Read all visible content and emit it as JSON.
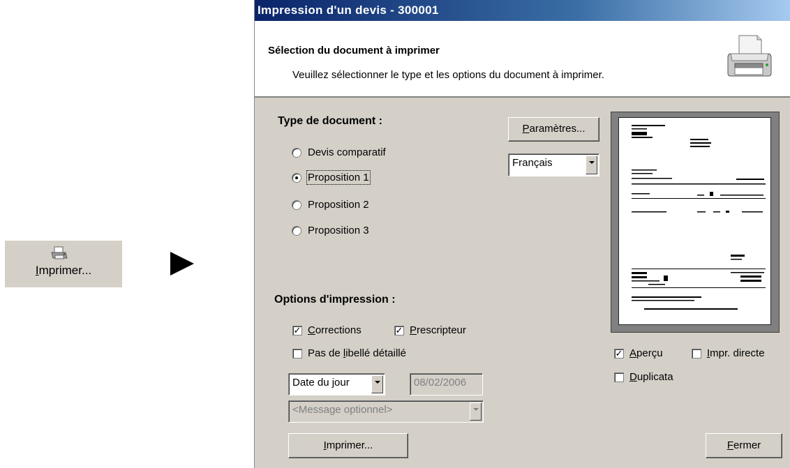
{
  "toolbar": {
    "print_label": "Imprimer..."
  },
  "dialog": {
    "title": "Impression d'un devis  -  300001",
    "header": {
      "title": "Sélection du document à imprimer",
      "subtitle": "Veuillez sélectionner le type et les options du document à imprimer."
    },
    "type_section": {
      "title": "Type de document :",
      "options": [
        {
          "label": "Devis comparatif",
          "selected": false
        },
        {
          "label": "Proposition 1",
          "selected": true
        },
        {
          "label": "Proposition 2",
          "selected": false
        },
        {
          "label": "Proposition 3",
          "selected": false
        }
      ]
    },
    "params_button": "Paramètres...",
    "language_select": {
      "value": "Français"
    },
    "options_section": {
      "title": "Options d'impression :",
      "corrections": {
        "label": "Corrections",
        "checked": true
      },
      "prescripteur": {
        "label": "Prescripteur",
        "checked": true
      },
      "no_detail": {
        "label": "Pas de libellé détaillé",
        "checked": false
      },
      "date_select": {
        "value": "Date du jour"
      },
      "date_value": "08/02/2006",
      "message_select": {
        "placeholder": "<Message optionnel>"
      }
    },
    "preview_options": {
      "apercu": {
        "label": "Aperçu",
        "checked": true
      },
      "direct": {
        "label": "Impr. directe",
        "checked": false
      },
      "duplicata": {
        "label": "Duplicata",
        "checked": false
      }
    },
    "print_button": "Imprimer...",
    "close_button": "Fermer"
  },
  "colors": {
    "dialog_bg": "#d4d0c8",
    "title_start": "#0a246a",
    "title_end": "#a6caf0"
  }
}
